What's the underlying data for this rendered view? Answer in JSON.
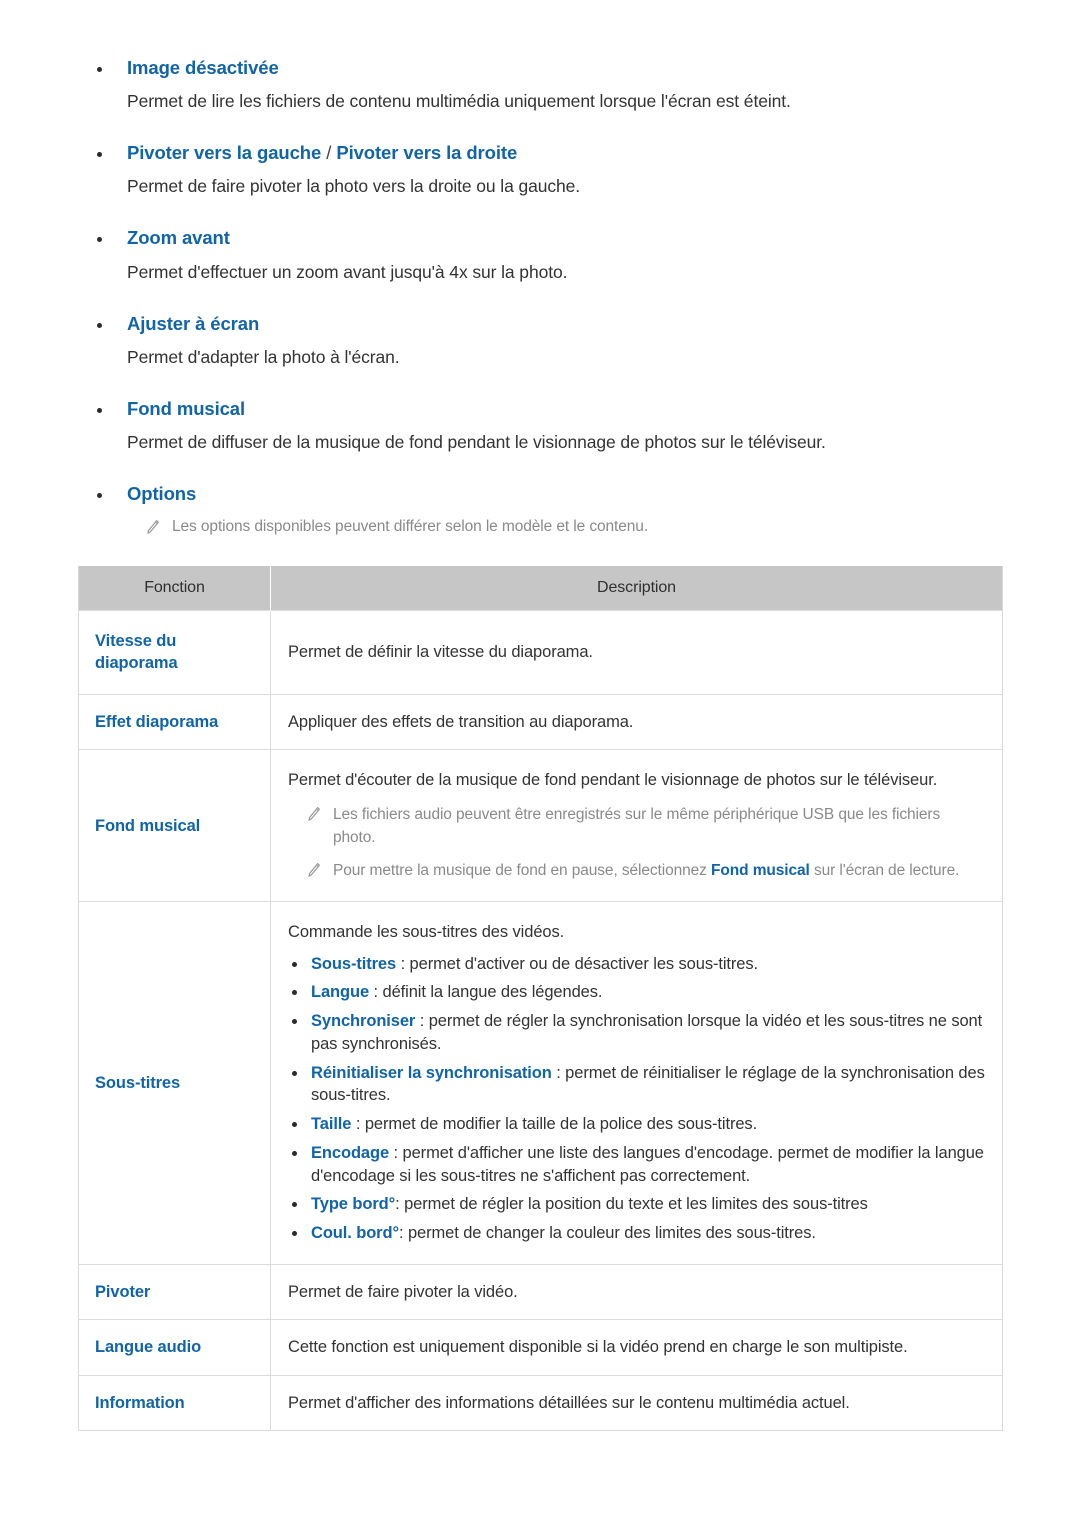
{
  "features": [
    {
      "title": "Image désactivée",
      "title_parts": null,
      "desc": "Permet de lire les fichiers de contenu multimédia uniquement lorsque l'écran est éteint."
    },
    {
      "title": "Pivoter vers la gauche / Pivoter vers la droite",
      "title_parts": {
        "left": "Pivoter vers la gauche",
        "sep": " / ",
        "right": "Pivoter vers la droite"
      },
      "desc": "Permet de faire pivoter la photo vers la droite ou la gauche."
    },
    {
      "title": "Zoom avant",
      "title_parts": null,
      "desc": "Permet d'effectuer un zoom avant jusqu'à 4x sur la photo."
    },
    {
      "title": "Ajuster à écran",
      "title_parts": null,
      "desc": "Permet d'adapter la photo à l'écran."
    },
    {
      "title": "Fond musical",
      "title_parts": null,
      "desc": "Permet de diffuser de la musique de fond pendant le visionnage de photos sur le téléviseur."
    },
    {
      "title": "Options",
      "title_parts": null,
      "desc": ""
    }
  ],
  "options_note": "Les options disponibles peuvent différer selon le modèle et le contenu.",
  "table": {
    "headers": [
      "Fonction",
      "Description"
    ],
    "rows": [
      {
        "function": "Vitesse du diaporama",
        "function_line1": "Vitesse du",
        "function_line2": "diaporama",
        "description": "Permet de définir la vitesse du diaporama."
      },
      {
        "function": "Effet diaporama",
        "description": "Appliquer des effets de transition au diaporama."
      },
      {
        "function": "Fond musical",
        "description": "Permet d'écouter de la musique de fond pendant le visionnage de photos sur le téléviseur.",
        "notes": [
          {
            "pre": "Les fichiers audio peuvent être enregistrés sur le même périphérique USB que les fichiers photo.",
            "hl": "",
            "post": ""
          },
          {
            "pre": "Pour mettre la musique de fond en pause, sélectionnez ",
            "hl": "Fond musical",
            "post": " sur l'écran de lecture."
          }
        ]
      },
      {
        "function": "Sous-titres",
        "description": "Commande les sous-titres des vidéos.",
        "sub_items": [
          {
            "term": "Sous-titres",
            "text": " : permet d'activer ou de désactiver les sous-titres."
          },
          {
            "term": "Langue",
            "text": " : définit la langue des légendes."
          },
          {
            "term": "Synchroniser",
            "text": " : permet de régler la synchronisation lorsque la vidéo et les sous-titres ne sont pas synchronisés."
          },
          {
            "term": "Réinitialiser la synchronisation",
            "text": " : permet de réinitialiser le réglage de la synchronisation des sous-titres."
          },
          {
            "term": "Taille",
            "text": " : permet de modifier la taille de la police des sous-titres."
          },
          {
            "term": "Encodage",
            "text": " : permet d'afficher une liste des langues d'encodage. permet de modifier la langue d'encodage si les sous-titres ne s'affichent pas correctement."
          },
          {
            "term": "Type bord°",
            "text": ": permet de régler la position du texte et les limites des sous-titres"
          },
          {
            "term": "Coul. bord°",
            "text": ": permet de changer la couleur des limites des sous-titres."
          }
        ]
      },
      {
        "function": "Pivoter",
        "description": "Permet de faire pivoter la vidéo."
      },
      {
        "function": "Langue audio",
        "description": "Cette fonction est uniquement disponible si la vidéo prend en charge le son multipiste."
      },
      {
        "function": "Information",
        "description": "Permet d'afficher des informations détaillées sur le contenu multimédia actuel."
      }
    ]
  },
  "colors": {
    "link_blue": "#1264a9",
    "body_text": "#333333",
    "note_gray": "#8a8a8a",
    "table_header_bg": "#c6c6c6",
    "table_border": "#dcdcdc"
  }
}
